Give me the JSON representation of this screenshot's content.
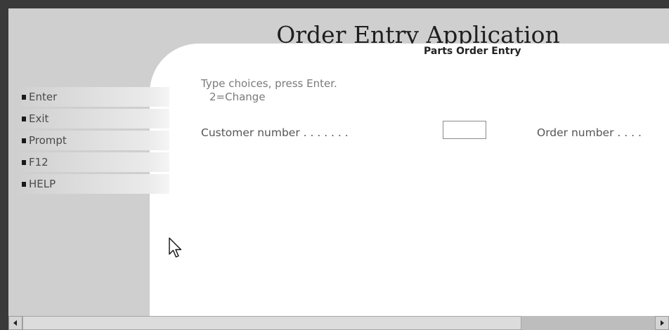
{
  "header": {
    "app_title": "Order Entry Application"
  },
  "screen": {
    "title": "Parts Order Entry",
    "instruction_line1": "Type choices, press Enter.",
    "instruction_line2": "2=Change"
  },
  "fields": {
    "customer_number": {
      "label": "Customer number . . . . . . .",
      "value": ""
    },
    "order_number": {
      "label": "Order number . . . ."
    }
  },
  "function_keys": [
    {
      "label": "Enter"
    },
    {
      "label": "Exit"
    },
    {
      "label": "Prompt"
    },
    {
      "label": "F12"
    },
    {
      "label": "HELP"
    }
  ],
  "icons": {
    "bullet": "square-bullet-icon",
    "cursor": "mouse-pointer-icon",
    "scroll_left": "scroll-left-arrow-icon",
    "scroll_right": "scroll-right-arrow-icon"
  },
  "colors": {
    "background": "#cfcfcf",
    "content": "#ffffff",
    "frame": "#3a3a3a"
  }
}
